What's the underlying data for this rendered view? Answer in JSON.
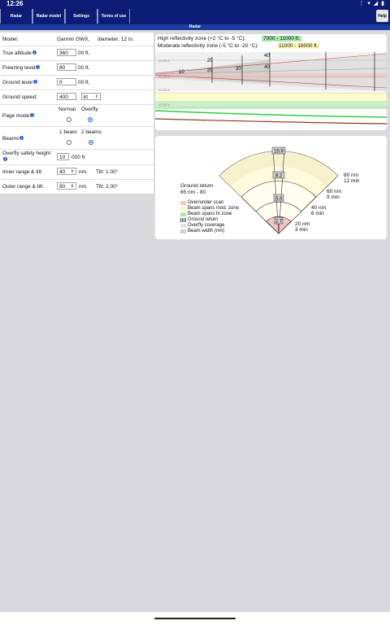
{
  "status": {
    "time": "12:26",
    "icons": "⋮ ▾ ◢ ▮"
  },
  "nav": {
    "tabs": [
      "Radar",
      "Radar model",
      "Settings",
      "Terms of use"
    ],
    "help": "Help"
  },
  "subtitle": "Radar",
  "form": {
    "model_label": "Model:",
    "model_value": "Garmin GWX,",
    "diameter": "diameter: 12 in.",
    "true_alt_label": "True altitude",
    "true_alt_value": "360",
    "true_alt_unit": "00 ft.",
    "freezing_label": "Freezing level",
    "freezing_value": "80",
    "freezing_unit": "00 ft.",
    "ground_label": "Ground level",
    "ground_value": "0",
    "ground_unit": "00 ft.",
    "speed_label": "Ground speed:",
    "speed_value": "400",
    "speed_unit": "kt",
    "page_mode_label": "Page mode",
    "page_mode_options": [
      "Normal",
      "Overfly"
    ],
    "page_mode_selected": "Overfly",
    "beams_label": "Beams",
    "beams_options": [
      "1 beam",
      "2 beams"
    ],
    "beams_selected": "2 beams",
    "overfly_label": "Overfly safety height",
    "overfly_value": "10",
    "overfly_unit": "000 ft",
    "inner_label": "Inner range & tilt:",
    "inner_value": "40",
    "inner_unit": "nm.",
    "inner_tilt": "Tilt: 1.00°",
    "outer_label": "Outer range & tilt:",
    "outer_value": "80",
    "outer_unit": "nm.",
    "outer_tilt": "Tilt: 2.00°"
  },
  "profile": {
    "high_zone_label": "High reflectivity zone (+2 °C to -5 °C):",
    "high_zone_value": "7000 - 11000 ft.",
    "mod_zone_label": "Moderate reflectivity zone (-5 °C to -20 °C):",
    "mod_zone_value": "11000 - 18000 ft.",
    "alt_labels": [
      "40,000 ft",
      "30,000 ft",
      "20,000 ft",
      "10,000 ft"
    ],
    "range_marks": [
      "10",
      "20",
      "20",
      "30",
      "40",
      "40"
    ]
  },
  "fan": {
    "beam_widths": [
      "10.9",
      "8.2",
      "5.4",
      "2.7"
    ],
    "ground_return_label": "Ground return",
    "ground_return_value": "65 nm - 80",
    "ranges": [
      {
        "nm": "80 nm",
        "min": "12 min"
      },
      {
        "nm": "60 nm",
        "min": "9 min"
      },
      {
        "nm": "40 nm",
        "min": "6 min"
      },
      {
        "nm": "20 nm",
        "min": "3 min"
      }
    ],
    "legend": [
      "Over/under scan",
      "Beam spans mod. zone",
      "Beam spans hi zone",
      "Ground return",
      "Overfly coverage",
      "Beam width (nm)"
    ],
    "colors": {
      "over_under": "#f7c4c4",
      "mod_zone": "#fff7b3",
      "hi_zone": "#a9e8a9",
      "ground": "#444444",
      "width": "#d0d0d0"
    }
  }
}
